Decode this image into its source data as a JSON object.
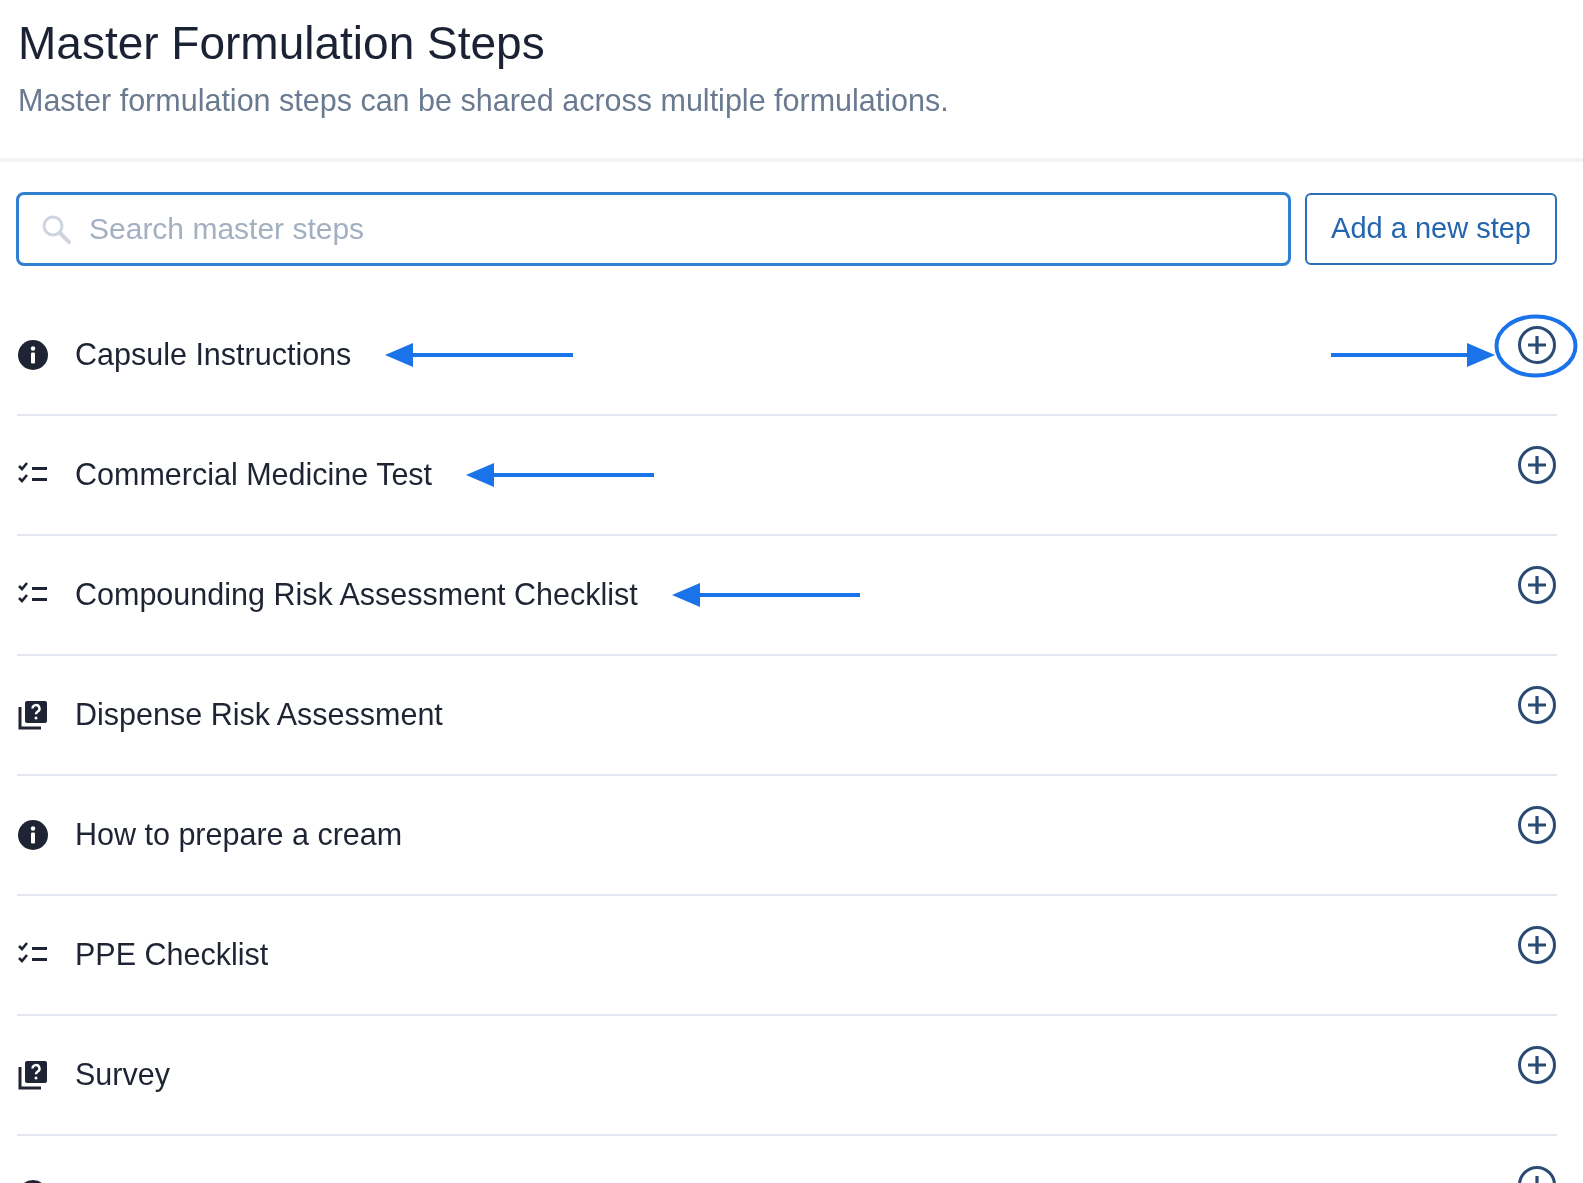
{
  "header": {
    "title": "Master Formulation Steps",
    "subtitle": "Master formulation steps can be shared across multiple formulations."
  },
  "search": {
    "placeholder": "Search master steps"
  },
  "add_button": "Add a new step",
  "steps": [
    {
      "kind": "info",
      "label": "Capsule Instructions",
      "arrow_left": true,
      "arrow_right": true,
      "circled": true
    },
    {
      "kind": "checklist",
      "label": "Commercial Medicine Test",
      "arrow_left": true,
      "arrow_right": false,
      "circled": false
    },
    {
      "kind": "checklist",
      "label": "Compounding Risk Assessment Checklist",
      "arrow_left": true,
      "arrow_right": false,
      "circled": false
    },
    {
      "kind": "question",
      "label": "Dispense Risk Assessment",
      "arrow_left": false,
      "arrow_right": false,
      "circled": false
    },
    {
      "kind": "info",
      "label": "How to prepare a cream",
      "arrow_left": false,
      "arrow_right": false,
      "circled": false
    },
    {
      "kind": "checklist",
      "label": "PPE Checklist",
      "arrow_left": false,
      "arrow_right": false,
      "circled": false
    },
    {
      "kind": "question",
      "label": "Survey",
      "arrow_left": false,
      "arrow_right": false,
      "circled": false
    },
    {
      "kind": "info",
      "arrow_left": false,
      "arrow_right": false,
      "circled": false
    }
  ]
}
